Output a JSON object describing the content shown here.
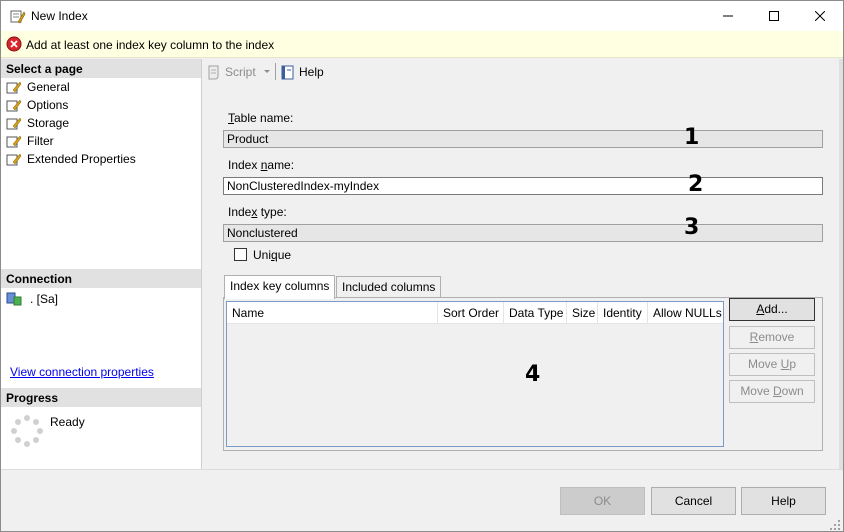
{
  "window": {
    "title": "New Index",
    "icon": "index-wrench-icon"
  },
  "error": {
    "message": "Add at least one index key column to the index",
    "icon": "error-circle-icon"
  },
  "left": {
    "select_page_header": "Select a page",
    "pages": [
      {
        "label": "General",
        "icon": "page-wrench-icon"
      },
      {
        "label": "Options",
        "icon": "page-wrench-icon"
      },
      {
        "label": "Storage",
        "icon": "page-wrench-icon"
      },
      {
        "label": "Filter",
        "icon": "page-wrench-icon"
      },
      {
        "label": "Extended Properties",
        "icon": "page-wrench-icon"
      }
    ],
    "connection_header": "Connection",
    "connection_value": ". [Sa]",
    "view_connection_link": "View connection properties",
    "progress_header": "Progress",
    "progress_status": "Ready"
  },
  "toolbar": {
    "script_label": "Script",
    "help_label": "Help"
  },
  "form": {
    "table_name_label_pre": "",
    "table_name_label_u": "T",
    "table_name_label_post": "able name:",
    "table_name_value": "Product",
    "index_name_label_pre": "Index ",
    "index_name_label_u": "n",
    "index_name_label_post": "ame:",
    "index_name_value": "NonClusteredIndex-myIndex",
    "index_type_label_pre": "Inde",
    "index_type_label_u": "x",
    "index_type_label_post": " type:",
    "index_type_value": "Nonclustered",
    "unique_label_pre": "Uni",
    "unique_label_u": "q",
    "unique_label_post": "ue",
    "unique_checked": false
  },
  "annotations": [
    "1",
    "2",
    "3",
    "4"
  ],
  "tabs": [
    {
      "label": "Index key columns",
      "active": true
    },
    {
      "label": "Included columns",
      "active": false
    }
  ],
  "grid": {
    "columns": [
      "Name",
      "Sort Order",
      "Data Type",
      "Size",
      "Identity",
      "Allow NULLs"
    ],
    "rows": []
  },
  "side_buttons": {
    "add_pre": "",
    "add_u": "A",
    "add_post": "dd...",
    "remove_pre": "",
    "remove_u": "R",
    "remove_post": "emove",
    "move_up_pre": "Move ",
    "move_up_u": "U",
    "move_up_post": "p",
    "move_down_pre": "Move ",
    "move_down_u": "D",
    "move_down_post": "own"
  },
  "footer": {
    "ok": "OK",
    "cancel": "Cancel",
    "help": "Help"
  }
}
